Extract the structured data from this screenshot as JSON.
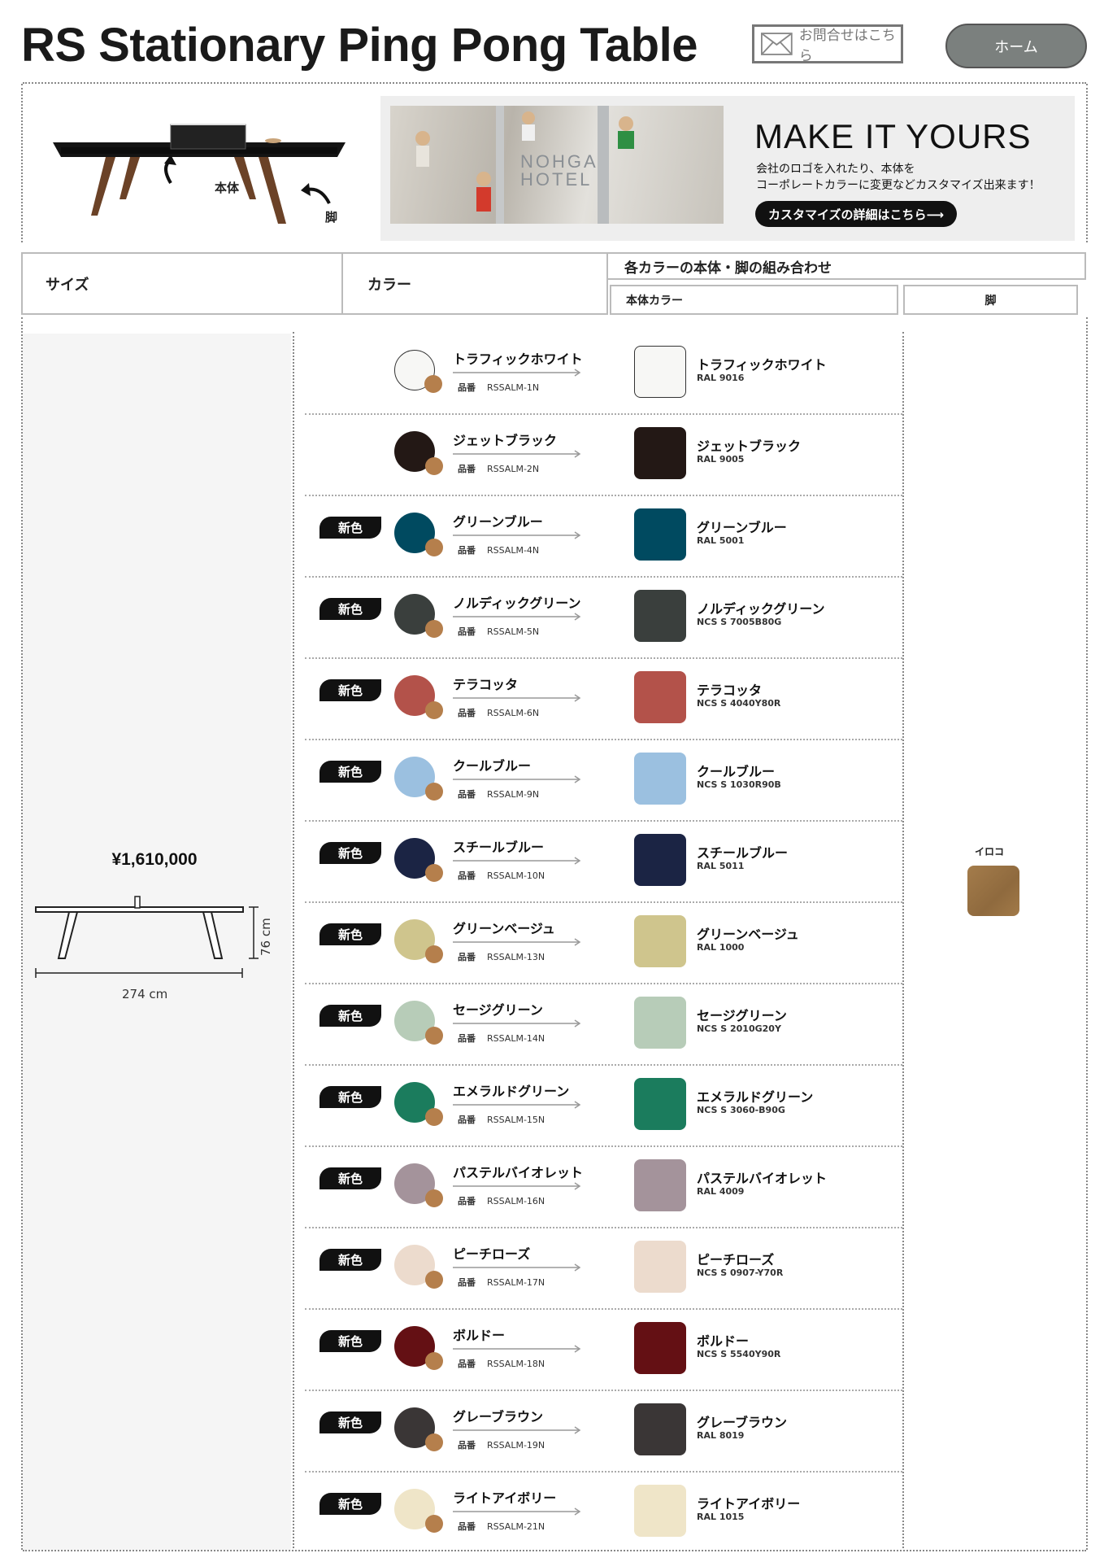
{
  "header": {
    "title": "RS Stationary Ping Pong Table",
    "contact_label": "お問合せはこちら",
    "home_label": "ホーム"
  },
  "hero": {
    "label_body": "本体",
    "label_leg": "脚"
  },
  "banner": {
    "hotel_name": "NOHGA HOTEL",
    "headline": "MAKE IT YOURS",
    "desc_line1": "会社のロゴを入れたり、本体を",
    "desc_line2": "コーポレートカラーに変更などカスタマイズ出来ます！",
    "cta": "カスタマイズの詳細はこちら⟶"
  },
  "columns": {
    "size": "サイズ",
    "color": "カラー",
    "combo": "各カラーの本体・脚の組み合わせ",
    "body_color": "本体カラー",
    "leg": "脚"
  },
  "size": {
    "price": "¥1,610,000",
    "width_label": "274 cm",
    "height_label": "76 cm"
  },
  "leg": {
    "label": "イロコ",
    "color": "#9a7444"
  },
  "new_badge": "新色",
  "part_label": "品番",
  "colors": [
    {
      "name": "トラフィックホワイト",
      "code": "RSSALM-1N",
      "ref": "RAL 9016",
      "hex": "#f7f7f5",
      "new": false
    },
    {
      "name": "ジェットブラック",
      "code": "RSSALM-2N",
      "ref": "RAL 9005",
      "hex": "#231815",
      "new": false
    },
    {
      "name": "グリーンブルー",
      "code": "RSSALM-4N",
      "ref": "RAL 5001",
      "hex": "#004a60",
      "new": true
    },
    {
      "name": "ノルディックグリーン",
      "code": "RSSALM-5N",
      "ref": "NCS S 7005B80G",
      "hex": "#3a3f3d",
      "new": true
    },
    {
      "name": "テラコッタ",
      "code": "RSSALM-6N",
      "ref": "NCS S 4040Y80R",
      "hex": "#b3524a",
      "new": true
    },
    {
      "name": "クールブルー",
      "code": "RSSALM-9N",
      "ref": "NCS S 1030R90B",
      "hex": "#9bc0e0",
      "new": true
    },
    {
      "name": "スチールブルー",
      "code": "RSSALM-10N",
      "ref": "RAL 5011",
      "hex": "#1b2444",
      "new": true
    },
    {
      "name": "グリーンベージュ",
      "code": "RSSALM-13N",
      "ref": "RAL 1000",
      "hex": "#cfc58d",
      "new": true
    },
    {
      "name": "セージグリーン",
      "code": "RSSALM-14N",
      "ref": "NCS S 2010G20Y",
      "hex": "#b7ccb8",
      "new": true
    },
    {
      "name": "エメラルドグリーン",
      "code": "RSSALM-15N",
      "ref": "NCS S 3060-B90G",
      "hex": "#1b7c5d",
      "new": true
    },
    {
      "name": "パステルバイオレット",
      "code": "RSSALM-16N",
      "ref": "RAL 4009",
      "hex": "#a4939b",
      "new": true
    },
    {
      "name": "ピーチローズ",
      "code": "RSSALM-17N",
      "ref": "NCS S 0907-Y70R",
      "hex": "#ecdbcd",
      "new": true
    },
    {
      "name": "ボルドー",
      "code": "RSSALM-18N",
      "ref": "NCS S 5540Y90R",
      "hex": "#641014",
      "new": true
    },
    {
      "name": "グレーブラウン",
      "code": "RSSALM-19N",
      "ref": "RAL 8019",
      "hex": "#3a3636",
      "new": true
    },
    {
      "name": "ライトアイボリー",
      "code": "RSSALM-21N",
      "ref": "RAL 1015",
      "hex": "#efe5c8",
      "new": true
    }
  ]
}
